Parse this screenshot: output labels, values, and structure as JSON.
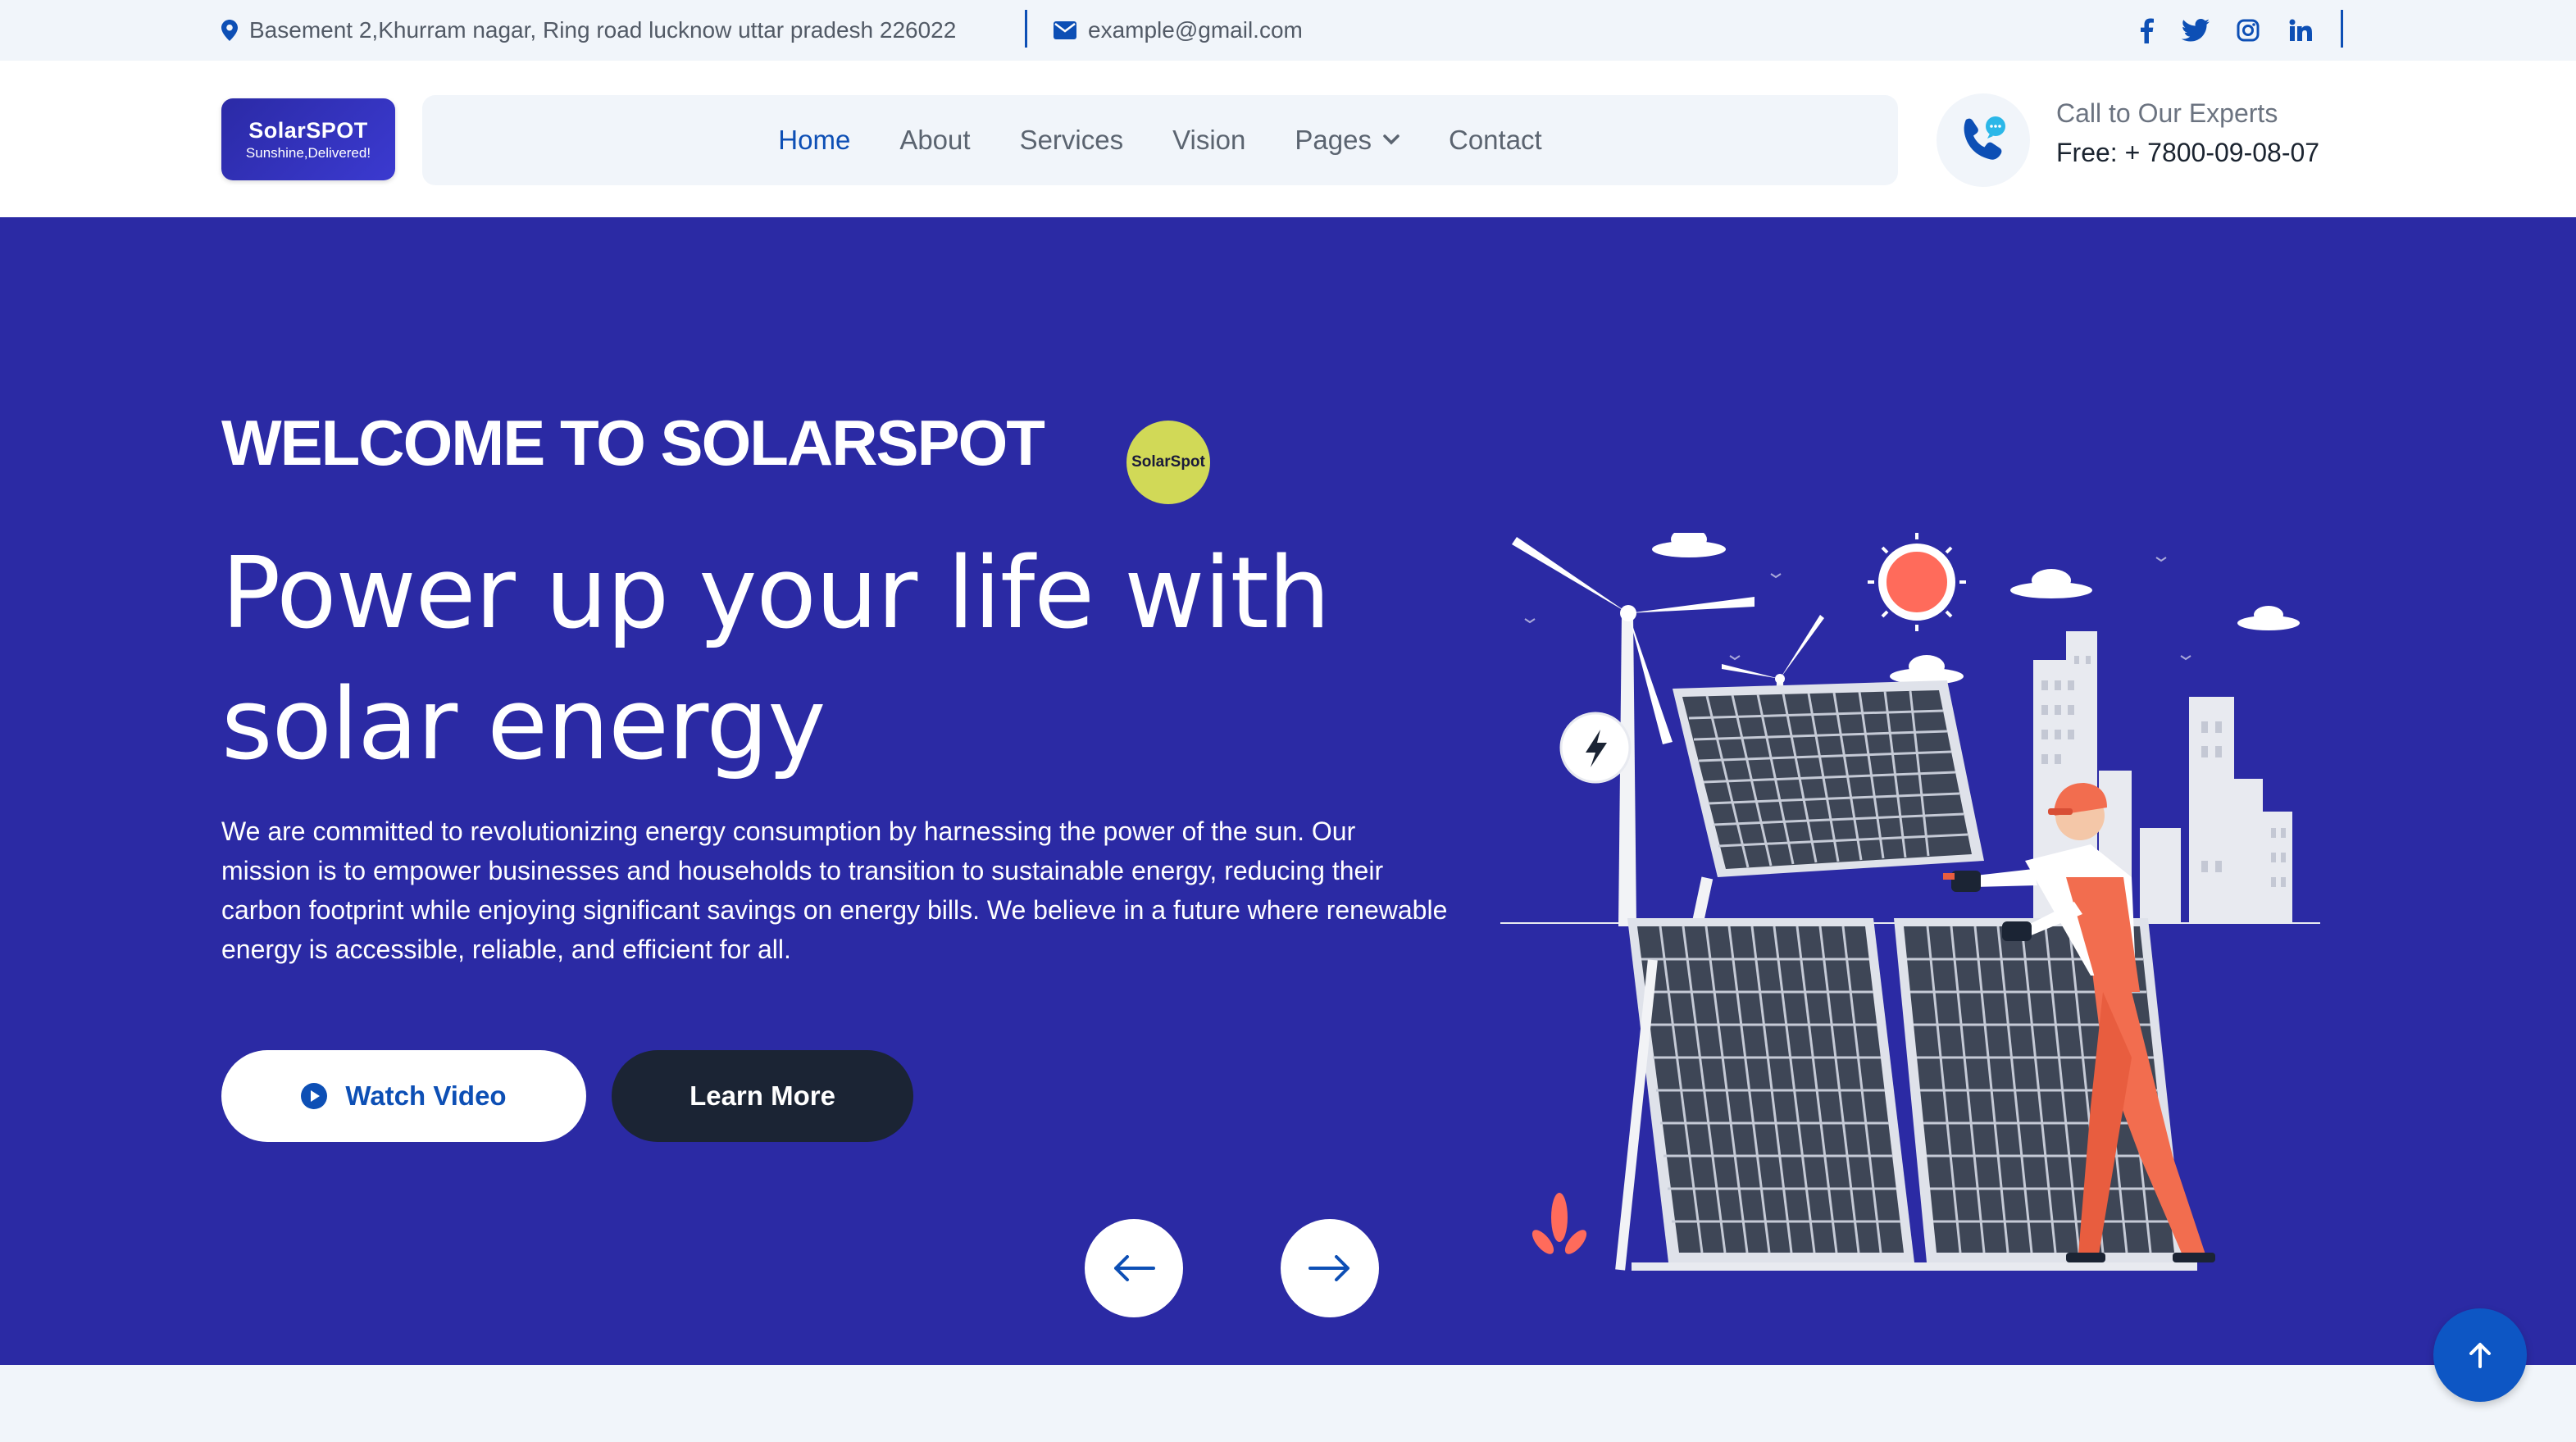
{
  "topbar": {
    "address": "Basement 2,Khurram nagar, Ring road lucknow uttar pradesh 226022",
    "email": "example@gmail.com",
    "social_icons": [
      "facebook-icon",
      "twitter-icon",
      "instagram-icon",
      "linkedin-icon"
    ]
  },
  "header": {
    "logo": {
      "name": "SolarSPOT",
      "tagline": "Sunshine,Delivered!"
    },
    "nav": {
      "home": "Home",
      "about": "About",
      "services": "Services",
      "vision": "Vision",
      "pages": "Pages",
      "contact": "Contact"
    },
    "call": {
      "label": "Call to Our Experts",
      "number": "Free: + 7800-09-08-07"
    }
  },
  "hero": {
    "welcome": "WELCOME TO SOLARSPOT",
    "badge": "SolarSpot",
    "headline_line1": "Power up your life with",
    "headline_line2": "solar energy",
    "description": "We are committed to revolutionizing energy consumption by harnessing the power of the sun. Our mission is to empower businesses and households to transition to sustainable energy, reducing their carbon footprint while enjoying significant savings on energy bills. We believe in a future where renewable energy is accessible, reliable, and efficient for all.",
    "watch_video": "Watch Video",
    "learn_more": "Learn More"
  },
  "colors": {
    "primary": "#0d4fb5",
    "hero_bg": "#2b2aa4",
    "dark_button": "#1b2434",
    "badge": "#d1d957",
    "light_bg": "#f1f5fa"
  }
}
